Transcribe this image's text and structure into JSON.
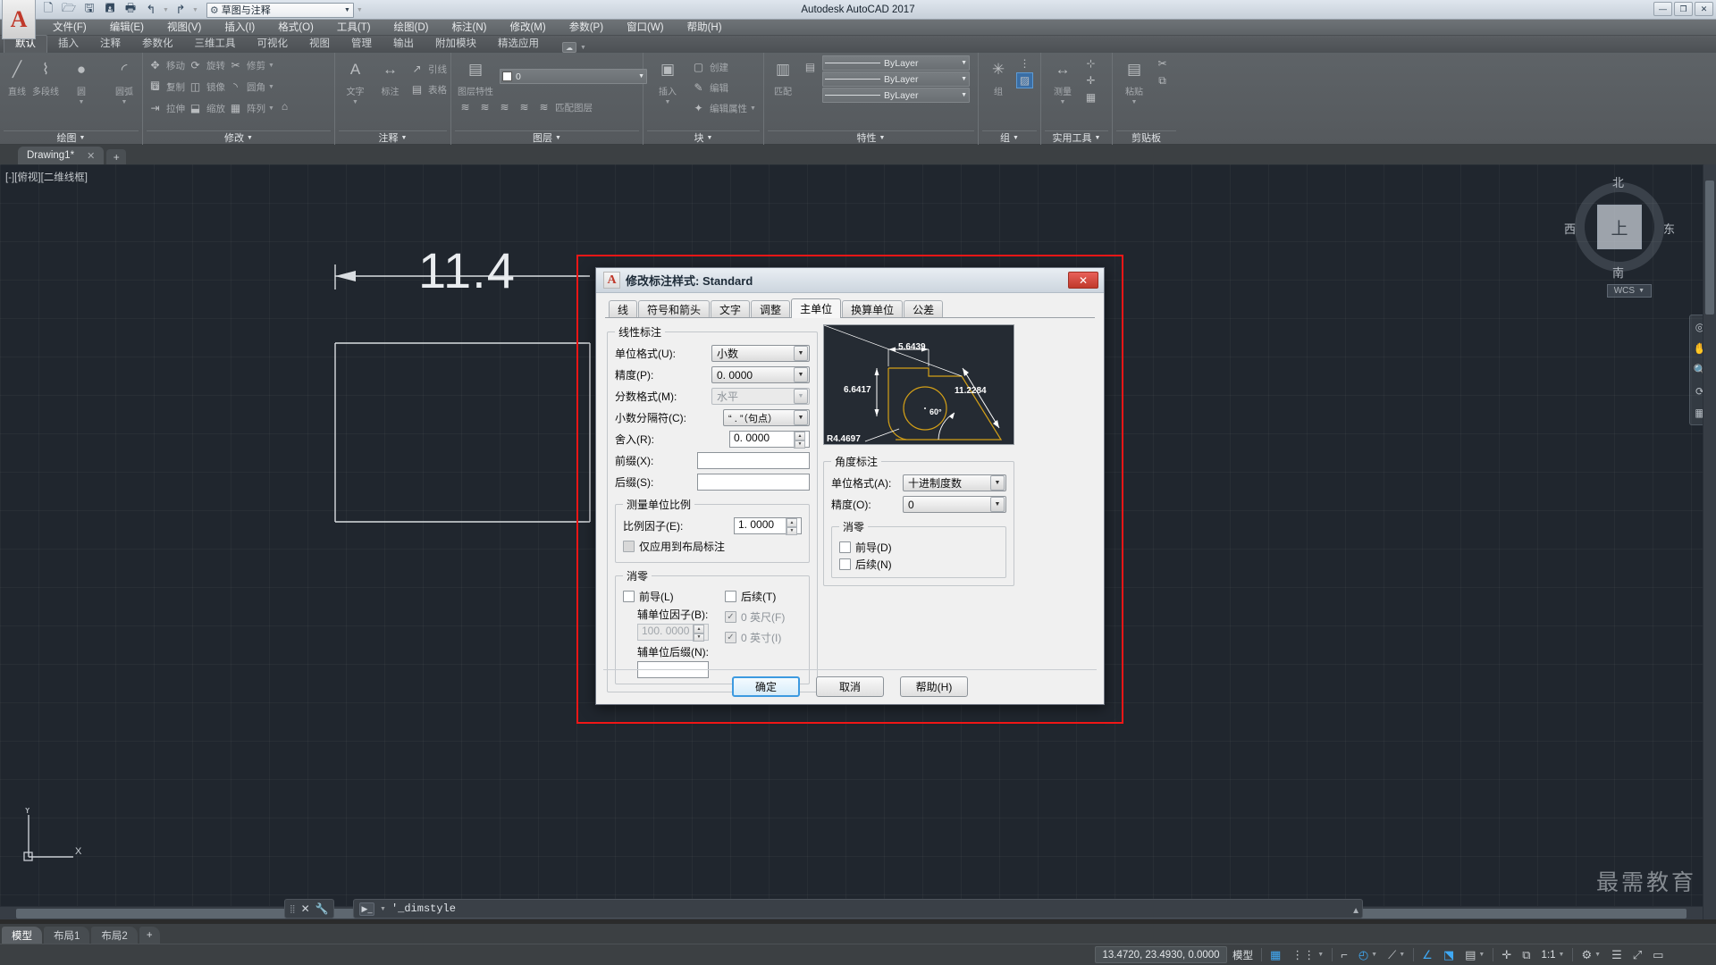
{
  "titlebar": {
    "app_title": "Autodesk AutoCAD 2017",
    "workspace": "草图与注释",
    "logo": "A",
    "quick_access": [
      {
        "name": "new-icon",
        "glyph": "🗋"
      },
      {
        "name": "open-icon",
        "glyph": "🗁"
      },
      {
        "name": "save-icon",
        "glyph": "🖫"
      },
      {
        "name": "saveas-icon",
        "glyph": "🖪"
      },
      {
        "name": "plot-icon",
        "glyph": "🖶"
      },
      {
        "name": "undo-icon",
        "glyph": "↰"
      },
      {
        "name": "redo-icon",
        "glyph": "↱"
      }
    ],
    "minimize": "—",
    "maximize": "❐",
    "close": "✕"
  },
  "menubar": [
    "文件(F)",
    "编辑(E)",
    "视图(V)",
    "插入(I)",
    "格式(O)",
    "工具(T)",
    "绘图(D)",
    "标注(N)",
    "修改(M)",
    "参数(P)",
    "窗口(W)",
    "帮助(H)"
  ],
  "ribbon_tabs": {
    "items": [
      "默认",
      "插入",
      "注释",
      "参数化",
      "三维工具",
      "可视化",
      "视图",
      "管理",
      "输出",
      "附加模块",
      "精选应用"
    ],
    "active": "默认"
  },
  "ribbon_panels": [
    {
      "label": "绘图",
      "big": [
        {
          "name": "line-tool",
          "label": "直线",
          "glyph": "╱"
        },
        {
          "name": "polyline-tool",
          "label": "多段线",
          "glyph": "⌇"
        },
        {
          "name": "circle-tool",
          "label": "圆",
          "glyph": "●"
        },
        {
          "name": "arc-tool",
          "label": "圆弧",
          "glyph": "◜"
        }
      ],
      "small": [
        {
          "name": "hatch-tool",
          "label": "",
          "glyph": "▨"
        }
      ]
    },
    {
      "label": "修改",
      "big": [
        {
          "name": "move-tool",
          "label": "移动",
          "glyph": "✥"
        },
        {
          "name": "rotate-tool",
          "label": "旋转",
          "glyph": "⟳"
        },
        {
          "name": "trim-tool",
          "label": "修剪",
          "glyph": "✂"
        },
        {
          "name": "copy-tool",
          "label": "复制",
          "glyph": "⧉"
        },
        {
          "name": "mirror-tool",
          "label": "镜像",
          "glyph": "◫"
        },
        {
          "name": "fillet-tool",
          "label": "圆角",
          "glyph": "◝"
        },
        {
          "name": "stretch-tool",
          "label": "拉伸",
          "glyph": "⇥"
        },
        {
          "name": "scale-tool",
          "label": "缩放",
          "glyph": "⬓"
        },
        {
          "name": "array-tool",
          "label": "阵列",
          "glyph": "▦"
        },
        {
          "name": "extrude-tool",
          "label": "",
          "glyph": "⌂"
        }
      ]
    },
    {
      "label": "注释",
      "big": [
        {
          "name": "text-tool",
          "label": "文字",
          "glyph": "A"
        },
        {
          "name": "dimension-tool",
          "label": "标注",
          "glyph": "↔"
        },
        {
          "name": "leader-tool",
          "label": "引线",
          "glyph": "↗"
        },
        {
          "name": "table-tool",
          "label": "表格",
          "glyph": "▤"
        }
      ]
    },
    {
      "label": "图层",
      "big": [
        {
          "name": "layer-properties-tool",
          "label": "图层特性",
          "glyph": "▤"
        },
        {
          "name": "layer-match-tool",
          "label": "匹配图层",
          "glyph": "≋"
        }
      ],
      "combo": {
        "name": "layer-combo",
        "value": "0",
        "swatch": "#ffffff"
      }
    },
    {
      "label": "块",
      "big": [
        {
          "name": "insert-block-tool",
          "label": "插入",
          "glyph": "▣"
        },
        {
          "name": "create-block-tool",
          "label": "创建",
          "glyph": "▢"
        },
        {
          "name": "edit-block-tool",
          "label": "编辑",
          "glyph": "✎"
        },
        {
          "name": "edit-attributes-tool",
          "label": "编辑属性",
          "glyph": "✦"
        }
      ]
    },
    {
      "label": "特性",
      "big": [
        {
          "name": "match-properties-tool",
          "label": "匹配",
          "glyph": "▥"
        }
      ],
      "combos": [
        {
          "name": "color-combo",
          "value": "ByLayer"
        },
        {
          "name": "linetype-combo",
          "value": "ByLayer"
        },
        {
          "name": "lineweight-combo",
          "value": "ByLayer"
        }
      ]
    },
    {
      "label": "组",
      "big": [
        {
          "name": "group-tool",
          "label": "组",
          "glyph": "✳"
        },
        {
          "name": "ungroup-tool",
          "label": "",
          "glyph": "⋮"
        },
        {
          "name": "group-edit-tool",
          "label": "",
          "glyph": "▨"
        }
      ]
    },
    {
      "label": "实用工具",
      "big": [
        {
          "name": "measure-tool",
          "label": "测量",
          "glyph": "↔"
        },
        {
          "name": "quickselect-tool",
          "label": "",
          "glyph": "⊹"
        },
        {
          "name": "point-tool",
          "label": "",
          "glyph": "✛"
        },
        {
          "name": "calculator-tool",
          "label": "",
          "glyph": "▦"
        }
      ]
    },
    {
      "label": "剪贴板",
      "big": [
        {
          "name": "paste-tool",
          "label": "粘贴",
          "glyph": "📋"
        },
        {
          "name": "cut-tool",
          "label": "",
          "glyph": "✂"
        },
        {
          "name": "copy-clip-tool",
          "label": "",
          "glyph": "⧉"
        }
      ]
    }
  ],
  "doctab": {
    "name": "Drawing1*",
    "close": "✕",
    "plus": "+"
  },
  "canvas": {
    "viewport_label": "[-][俯视][二维线框]",
    "dimension_text": "11.4",
    "compass": {
      "north": "北",
      "south": "南",
      "east": "东",
      "west": "西",
      "cube_label": "上",
      "wcs": "WCS"
    },
    "watermark": "最需教育"
  },
  "command": {
    "text": "'_dimstyle",
    "prompt_glyph": "▶_",
    "close_glyph": "✕",
    "settings_glyph": "🔧"
  },
  "layout_tabs": {
    "items": [
      "模型",
      "布局1",
      "布局2"
    ],
    "active": "模型",
    "plus": "+"
  },
  "statusbar": {
    "coordinates": "13.4720, 23.4930, 0.0000",
    "model_label": "模型",
    "scale": "1:1",
    "items": [
      {
        "name": "grid-toggle",
        "glyph": "▦"
      },
      {
        "name": "snap-toggle",
        "glyph": "⋮⋮"
      },
      {
        "name": "ortho-toggle",
        "glyph": "⌐"
      },
      {
        "name": "polar-toggle",
        "glyph": "◴"
      },
      {
        "name": "osnap-toggle",
        "glyph": "⟋"
      },
      {
        "name": "otrack-toggle",
        "glyph": "∠"
      },
      {
        "name": "dyn-ucs-toggle",
        "glyph": "⬔"
      },
      {
        "name": "lineweight-toggle",
        "glyph": "▤"
      },
      {
        "name": "transparency-toggle",
        "glyph": "◫"
      },
      {
        "name": "selection-cycling",
        "glyph": "⧉"
      },
      {
        "name": "annotation-monitor",
        "glyph": "✛"
      },
      {
        "name": "annotation-scale",
        "glyph": "◈"
      },
      {
        "name": "workspace-switch",
        "glyph": "⚙"
      },
      {
        "name": "customize",
        "glyph": "☰"
      },
      {
        "name": "fullscreen",
        "glyph": "⤢"
      },
      {
        "name": "cleanscreen",
        "glyph": "▭"
      }
    ]
  },
  "dialog": {
    "title": "修改标注样式: Standard",
    "logo": "A",
    "close": "✕",
    "tabs": {
      "items": [
        "线",
        "符号和箭头",
        "文字",
        "调整",
        "主单位",
        "换算单位",
        "公差"
      ],
      "active": "主单位"
    },
    "linear": {
      "legend": "线性标注",
      "fields": [
        {
          "name": "unit-format-combo",
          "label": "单位格式(U):",
          "value": "小数",
          "disabled": false
        },
        {
          "name": "precision-combo",
          "label": "精度(P):",
          "value": "0. 0000",
          "disabled": false
        },
        {
          "name": "fraction-format-combo",
          "label": "分数格式(M):",
          "value": "水平",
          "disabled": true
        },
        {
          "name": "decimal-separator-combo",
          "label": "小数分隔符(C):",
          "value": "“ . ”（句点）",
          "disabled": false
        }
      ],
      "round_label": "舍入(R):",
      "round_value": "0. 0000",
      "prefix_label": "前缀(X):",
      "prefix_value": "",
      "suffix_label": "后缀(S):",
      "suffix_value": ""
    },
    "measure_scale": {
      "legend": "测量单位比例",
      "factor_label": "比例因子(E):",
      "factor_value": "1. 0000",
      "layout_only_label": "仅应用到布局标注",
      "layout_only_checked": false
    },
    "zero_suppress_linear": {
      "legend": "消零",
      "leading_label": "前导(L)",
      "leading_checked": false,
      "trailing_label": "后续(T)",
      "trailing_checked": false,
      "sub_factor_label": "辅单位因子(B):",
      "sub_factor_value": "100. 0000",
      "sub_suffix_label": "辅单位后缀(N):",
      "sub_suffix_value": "",
      "feet_label": "0 英尺(F)",
      "feet_checked": true,
      "inch_label": "0 英寸(I)",
      "inch_checked": true
    },
    "angular": {
      "legend": "角度标注",
      "unit_format_label": "单位格式(A):",
      "unit_format_value": "十进制度数",
      "precision_label": "精度(O):",
      "precision_value": "0",
      "zero_legend": "消零",
      "leading_label": "前导(D)",
      "leading_checked": false,
      "trailing_label": "后续(N)",
      "trailing_checked": false
    },
    "preview": {
      "dim_top": "5.6439",
      "dim_left": "6.6417",
      "dim_right": "11.2284",
      "dim_angle": "60°",
      "dim_radius": "R4.4697"
    },
    "buttons": {
      "ok": "确定",
      "cancel": "取消",
      "help": "帮助(H)"
    }
  }
}
